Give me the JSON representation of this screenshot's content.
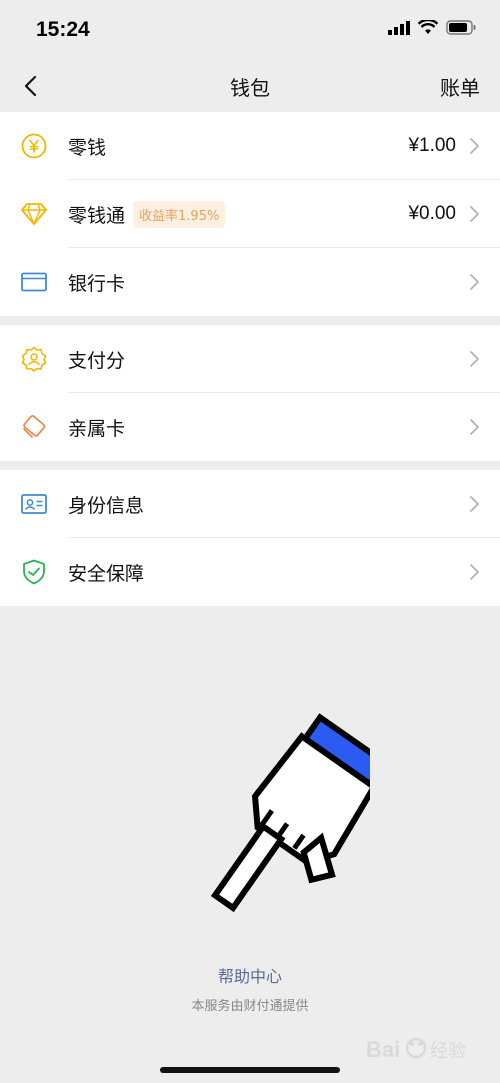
{
  "status_bar": {
    "time": "15:24"
  },
  "nav": {
    "title": "钱包",
    "right_label": "账单"
  },
  "groups": [
    {
      "items": [
        {
          "icon": "yen-coin-icon",
          "label": "零钱",
          "value": "¥1.00"
        },
        {
          "icon": "diamond-icon",
          "label": "零钱通",
          "badge": "收益率1.95%",
          "value": "¥0.00"
        },
        {
          "icon": "bank-card-icon",
          "label": "银行卡",
          "value": ""
        }
      ]
    },
    {
      "items": [
        {
          "icon": "pay-score-icon",
          "label": "支付分"
        },
        {
          "icon": "family-card-icon",
          "label": "亲属卡"
        }
      ]
    },
    {
      "items": [
        {
          "icon": "id-card-icon",
          "label": "身份信息"
        },
        {
          "icon": "shield-check-icon",
          "label": "安全保障"
        }
      ]
    }
  ],
  "footer": {
    "help_link": "帮助中心",
    "provider_text": "本服务由财付通提供"
  },
  "watermark": {
    "text": "Bai 经验"
  },
  "colors": {
    "background": "#ededed",
    "card": "#ffffff",
    "link": "#576b95",
    "badge_bg": "#fdf0e2",
    "badge_text": "#e8a05a",
    "yen_icon": "#f5b600",
    "bank_icon": "#3d8bd8",
    "shield_icon": "#26b552",
    "pointer_accent": "#2b5bf0"
  }
}
